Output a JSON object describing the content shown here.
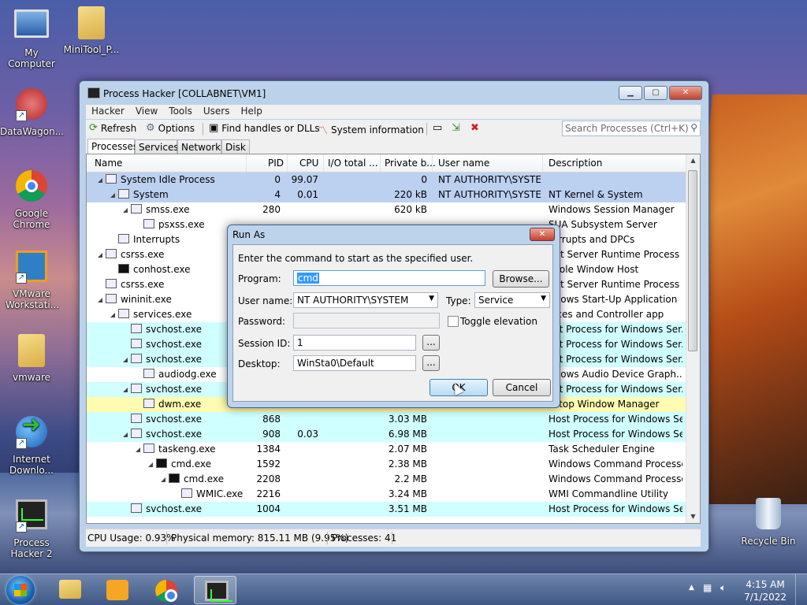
{
  "desktop": {
    "icons": [
      {
        "label": "My Computer"
      },
      {
        "label": "MiniTool_P..."
      },
      {
        "label": "DataWagon..."
      },
      {
        "label": "Google Chrome"
      },
      {
        "label": "VMware Workstati..."
      },
      {
        "label": "vmware"
      },
      {
        "label": "Internet Downlo..."
      },
      {
        "label": "Process Hacker 2"
      },
      {
        "label": "Recycle Bin"
      }
    ]
  },
  "window": {
    "title": "Process Hacker [COLLABNET\\VM1]",
    "menu": [
      "Hacker",
      "View",
      "Tools",
      "Users",
      "Help"
    ],
    "toolbar": {
      "refresh": "Refresh",
      "options": "Options",
      "find": "Find handles or DLLs",
      "sysinfo": "System information",
      "search_placeholder": "Search Processes (Ctrl+K)"
    },
    "tabs": [
      "Processes",
      "Services",
      "Network",
      "Disk"
    ],
    "columns": [
      "Name",
      "PID",
      "CPU",
      "I/O total ...",
      "Private b...",
      "User name",
      "Description"
    ],
    "rows": [
      {
        "name": "System Idle Process",
        "pid": "0",
        "cpu": "99.07",
        "io": "",
        "priv": "0",
        "user": "NT AUTHORITY\\SYSTEM",
        "desc": ""
      },
      {
        "name": "System",
        "pid": "4",
        "cpu": "0.01",
        "io": "",
        "priv": "220 kB",
        "user": "NT AUTHORITY\\SYSTEM",
        "desc": "NT Kernel & System"
      },
      {
        "name": "smss.exe",
        "pid": "280",
        "cpu": "",
        "io": "",
        "priv": "620 kB",
        "user": "",
        "desc": "Windows Session Manager"
      },
      {
        "name": "psxss.exe",
        "pid": "",
        "cpu": "",
        "io": "",
        "priv": "",
        "user": "",
        "desc": "SUA Subsystem Server"
      },
      {
        "name": "Interrupts",
        "pid": "",
        "cpu": "",
        "io": "",
        "priv": "",
        "user": "",
        "desc": "terrupts and DPCs"
      },
      {
        "name": "csrss.exe",
        "pid": "",
        "cpu": "",
        "io": "",
        "priv": "",
        "user": "",
        "desc": "ent Server Runtime Process"
      },
      {
        "name": "conhost.exe",
        "pid": "",
        "cpu": "",
        "io": "",
        "priv": "",
        "user": "",
        "desc": "nsole Window Host"
      },
      {
        "name": "csrss.exe",
        "pid": "",
        "cpu": "",
        "io": "",
        "priv": "",
        "user": "",
        "desc": "ent Server Runtime Process"
      },
      {
        "name": "wininit.exe",
        "pid": "",
        "cpu": "",
        "io": "",
        "priv": "",
        "user": "",
        "desc": "ndows Start-Up Application"
      },
      {
        "name": "services.exe",
        "pid": "",
        "cpu": "",
        "io": "",
        "priv": "",
        "user": "",
        "desc": "vices and Controller app"
      },
      {
        "name": "svchost.exe",
        "pid": "",
        "cpu": "",
        "io": "",
        "priv": "",
        "user": "",
        "desc": "ost Process for Windows Ser..."
      },
      {
        "name": "svchost.exe",
        "pid": "",
        "cpu": "",
        "io": "",
        "priv": "",
        "user": "",
        "desc": "ost Process for Windows Ser..."
      },
      {
        "name": "svchost.exe",
        "pid": "",
        "cpu": "",
        "io": "",
        "priv": "",
        "user": "",
        "desc": "ost Process for Windows Ser..."
      },
      {
        "name": "audiodg.exe",
        "pid": "",
        "cpu": "",
        "io": "",
        "priv": "",
        "user": "",
        "desc": "ndows Audio Device Graph..."
      },
      {
        "name": "svchost.exe",
        "pid": "",
        "cpu": "",
        "io": "",
        "priv": "",
        "user": "",
        "desc": "ost Process for Windows Ser..."
      },
      {
        "name": "dwm.exe",
        "pid": "",
        "cpu": "",
        "io": "",
        "priv": "",
        "user": "",
        "desc": "sktop Window Manager"
      },
      {
        "name": "svchost.exe",
        "pid": "868",
        "cpu": "",
        "io": "",
        "priv": "3.03 MB",
        "user": "",
        "desc": "Host Process for Windows Ser..."
      },
      {
        "name": "svchost.exe",
        "pid": "908",
        "cpu": "0.03",
        "io": "",
        "priv": "6.98 MB",
        "user": "",
        "desc": "Host Process for Windows Ser..."
      },
      {
        "name": "taskeng.exe",
        "pid": "1384",
        "cpu": "",
        "io": "",
        "priv": "2.07 MB",
        "user": "",
        "desc": "Task Scheduler Engine"
      },
      {
        "name": "cmd.exe",
        "pid": "1592",
        "cpu": "",
        "io": "",
        "priv": "2.38 MB",
        "user": "",
        "desc": "Windows Command Processor"
      },
      {
        "name": "cmd.exe",
        "pid": "2208",
        "cpu": "",
        "io": "",
        "priv": "2.2 MB",
        "user": "",
        "desc": "Windows Command Processor"
      },
      {
        "name": "WMIC.exe",
        "pid": "2216",
        "cpu": "",
        "io": "",
        "priv": "3.24 MB",
        "user": "",
        "desc": "WMI Commandline Utility"
      },
      {
        "name": "svchost.exe",
        "pid": "1004",
        "cpu": "",
        "io": "",
        "priv": "3.51 MB",
        "user": "",
        "desc": "Host Process for Windows Ser..."
      }
    ],
    "status": {
      "cpu": "CPU Usage: 0.93%",
      "mem": "Physical memory: 815.11 MB (9.95%)",
      "procs": "Processes: 41"
    }
  },
  "dialog": {
    "title": "Run As",
    "instruction": "Enter the command to start as the specified user.",
    "program_label": "Program:",
    "program_value": "cmd",
    "browse": "Browse...",
    "user_label": "User name:",
    "user_value": "NT AUTHORITY\\SYSTEM",
    "type_label": "Type:",
    "type_value": "Service",
    "password_label": "Password:",
    "toggle_elevation": "Toggle elevation",
    "session_label": "Session ID:",
    "session_value": "1",
    "desktop_label": "Desktop:",
    "desktop_value": "WinSta0\\Default",
    "ellipsis": "...",
    "ok": "OK",
    "cancel": "Cancel"
  },
  "taskbar": {
    "time": "4:15 AM",
    "date": "7/1/2022"
  }
}
